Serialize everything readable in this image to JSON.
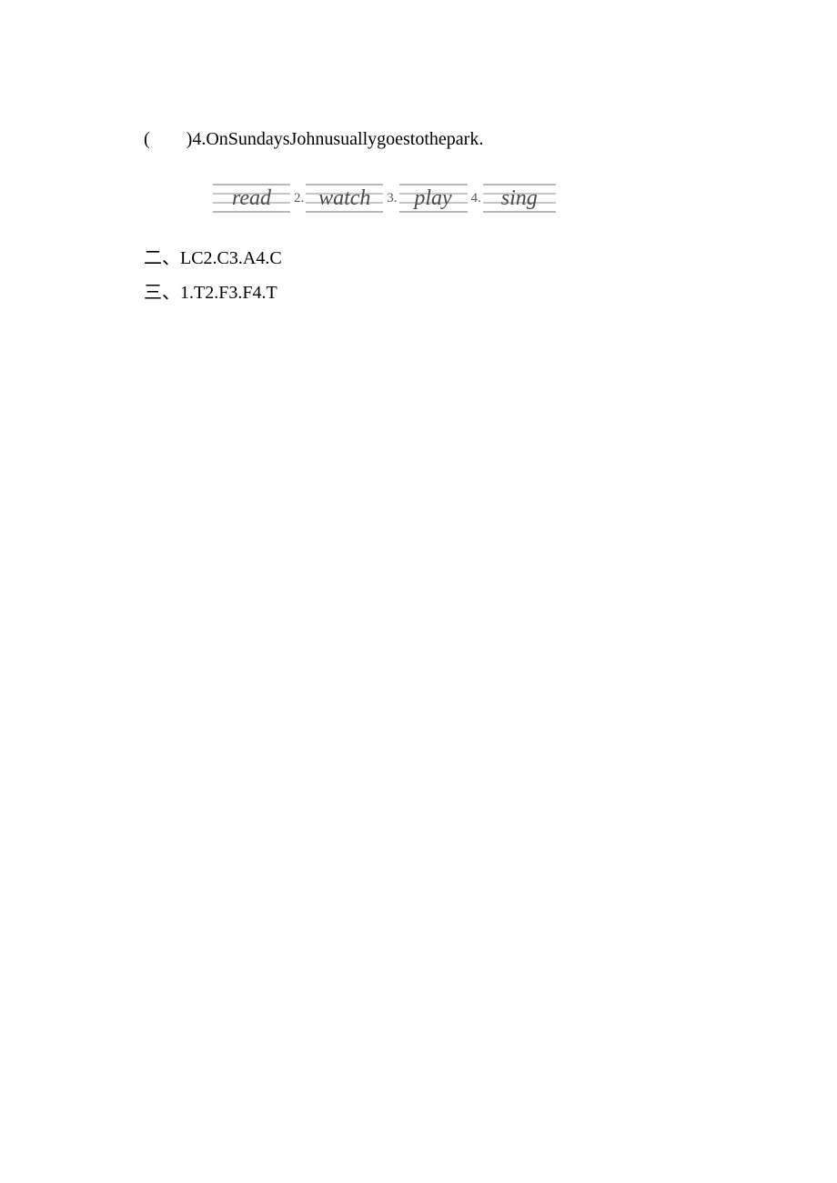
{
  "question": {
    "paren_open": "(",
    "paren_close": ")",
    "number": "4.",
    "text": "OnSundaysJohnusuallygoestothepark."
  },
  "handwriting": {
    "items": [
      {
        "num": "",
        "word": "read"
      },
      {
        "num": "2.",
        "word": "watch"
      },
      {
        "num": "3.",
        "word": "play"
      },
      {
        "num": "4.",
        "word": "sing"
      }
    ]
  },
  "answers": {
    "section2_label": "二、",
    "section2_text": "LC2.C3.A4.C",
    "section3_label": "三、",
    "section3_text": "1.T2.F3.F4.T"
  }
}
